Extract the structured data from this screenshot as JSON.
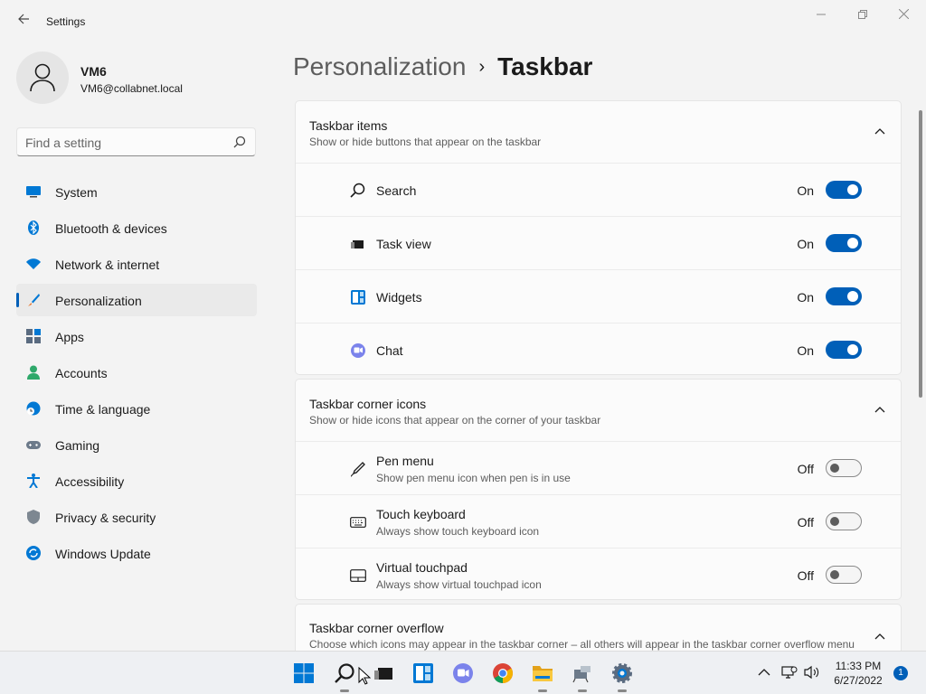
{
  "window": {
    "title": "Settings"
  },
  "user": {
    "name": "VM6",
    "email": "VM6@collabnet.local"
  },
  "search": {
    "placeholder": "Find a setting"
  },
  "sidebar": {
    "items": [
      {
        "label": "System",
        "icon": "monitor-icon"
      },
      {
        "label": "Bluetooth & devices",
        "icon": "bluetooth-icon"
      },
      {
        "label": "Network & internet",
        "icon": "wifi-icon"
      },
      {
        "label": "Personalization",
        "icon": "brush-icon",
        "selected": true
      },
      {
        "label": "Apps",
        "icon": "apps-icon"
      },
      {
        "label": "Accounts",
        "icon": "person-icon"
      },
      {
        "label": "Time & language",
        "icon": "globe-clock-icon"
      },
      {
        "label": "Gaming",
        "icon": "controller-icon"
      },
      {
        "label": "Accessibility",
        "icon": "accessibility-icon"
      },
      {
        "label": "Privacy & security",
        "icon": "shield-icon"
      },
      {
        "label": "Windows Update",
        "icon": "update-icon"
      }
    ]
  },
  "breadcrumb": {
    "parent": "Personalization",
    "separator": "›",
    "current": "Taskbar"
  },
  "sections": {
    "taskbar_items": {
      "title": "Taskbar items",
      "subtitle": "Show or hide buttons that appear on the taskbar",
      "rows": [
        {
          "label": "Search",
          "state": "On",
          "on": true,
          "icon": "search-icon"
        },
        {
          "label": "Task view",
          "state": "On",
          "on": true,
          "icon": "task-view-icon"
        },
        {
          "label": "Widgets",
          "state": "On",
          "on": true,
          "icon": "widgets-icon"
        },
        {
          "label": "Chat",
          "state": "On",
          "on": true,
          "icon": "chat-icon"
        }
      ]
    },
    "corner_icons": {
      "title": "Taskbar corner icons",
      "subtitle": "Show or hide icons that appear on the corner of your taskbar",
      "rows": [
        {
          "label": "Pen menu",
          "desc": "Show pen menu icon when pen is in use",
          "state": "Off",
          "on": false,
          "icon": "pen-icon"
        },
        {
          "label": "Touch keyboard",
          "desc": "Always show touch keyboard icon",
          "state": "Off",
          "on": false,
          "icon": "keyboard-icon"
        },
        {
          "label": "Virtual touchpad",
          "desc": "Always show virtual touchpad icon",
          "state": "Off",
          "on": false,
          "icon": "touchpad-icon"
        }
      ]
    },
    "corner_overflow": {
      "title": "Taskbar corner overflow",
      "subtitle": "Choose which icons may appear in the taskbar corner – all others will appear in the taskbar corner overflow menu"
    }
  },
  "taskbar": {
    "time": "11:33 PM",
    "date": "6/27/2022",
    "notifications": "1",
    "apps": [
      "start-icon",
      "search-icon",
      "task-view-icon",
      "widgets-icon",
      "chat-icon",
      "chrome-icon",
      "file-explorer-icon",
      "network-app-icon",
      "settings-icon"
    ]
  },
  "colors": {
    "accent": "#005fb8",
    "background": "#f3f3f3",
    "card": "#fbfbfb"
  }
}
